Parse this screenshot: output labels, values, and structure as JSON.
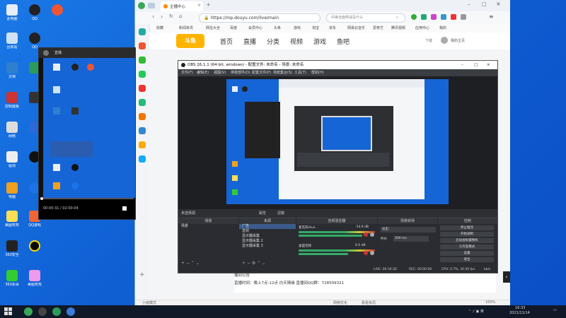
{
  "desktop": {
    "icons_col1": [
      "此电脑",
      "回收站",
      "文档",
      "",
      "控制面板",
      "网络",
      "驱动",
      "电脑",
      "程序",
      "美图秀秀",
      "360安全",
      "腾讯视频",
      "",
      "360杀毒"
    ],
    "icons_col2": [
      "QQ",
      "QQ",
      "",
      "",
      "",
      "",
      "",
      "",
      "",
      "",
      "QQ游戏",
      "",
      "",
      "美图秀秀"
    ],
    "colors": {
      "desktop": "#1565d6",
      "taskbar": "#111827"
    }
  },
  "player": {
    "title": "直播",
    "time": "00:00:31 / 02:00:04"
  },
  "browser": {
    "tab_title": "主播中心",
    "url": "https://mp.douyu.com/live/main",
    "search_placeholder": "中美全面停战没什么",
    "bookmarks": [
      "收藏",
      "新闻资讯",
      "网址大全",
      "百度",
      "会员中心",
      "头条",
      "游戏",
      "淘宝",
      "京东",
      "网易云音乐",
      "爱奇艺",
      "腾讯视频",
      "应用中心",
      "我的"
    ],
    "right_icons": [
      "下载",
      "我的主页"
    ],
    "status_left": "小窗模式",
    "status_mid": "网络优化",
    "status_right2": "看看资讯",
    "zoom": "100%"
  },
  "douyu": {
    "logo": "斗鱼",
    "nav": [
      "首页",
      "直播",
      "分类",
      "视频",
      "游戏",
      "鱼吧"
    ],
    "live_label": "播间公告",
    "live_time": "直播时间：晚上7点-12点 白天随缘 直播间QQ群：728509321"
  },
  "obs": {
    "title": "OBS 26.1.1 (64-bit, windows) - 配置文件: 未命名 - 场景: 未命名",
    "menu": [
      "文件(F)",
      "编辑(E)",
      "视图(V)",
      "停靠部件(D)",
      "配置文件(P)",
      "场景集合(S)",
      "工具(T)",
      "帮助(H)"
    ],
    "scene_label": "未选择源",
    "scene_buttons": [
      "属性",
      "滤镜"
    ],
    "docks": {
      "scenes": {
        "title": "场景",
        "items": [
          "场景"
        ]
      },
      "sources": {
        "title": "来源",
        "items": [
          "广告",
          "音效",
          "显示器采集",
          "显示器采集 2",
          "显示器采集 3"
        ]
      },
      "mixer": {
        "title": "音频混音器",
        "channels": [
          {
            "name": "麦克风/Aux",
            "db": "-14.9 dB"
          },
          {
            "name": "桌面音频",
            "db": "0.0 dB"
          }
        ]
      },
      "transitions": {
        "title": "场景转场",
        "type": "淡出",
        "duration_label": "时长",
        "duration": "300 ms"
      },
      "controls": {
        "title": "控制",
        "buttons": [
          "停止推流",
          "开始录制",
          "启动虚拟摄像机",
          "工作室模式",
          "设置",
          "退出"
        ]
      }
    },
    "status": {
      "live": "LIVE: 00:30:30",
      "rec": "REC: 00:00:00",
      "cpu": "CPU: 0.7%, 30.00 fps",
      "kbps": "kb/s"
    }
  },
  "taskbar": {
    "clock": "16:33",
    "date": "2021/11/14"
  }
}
